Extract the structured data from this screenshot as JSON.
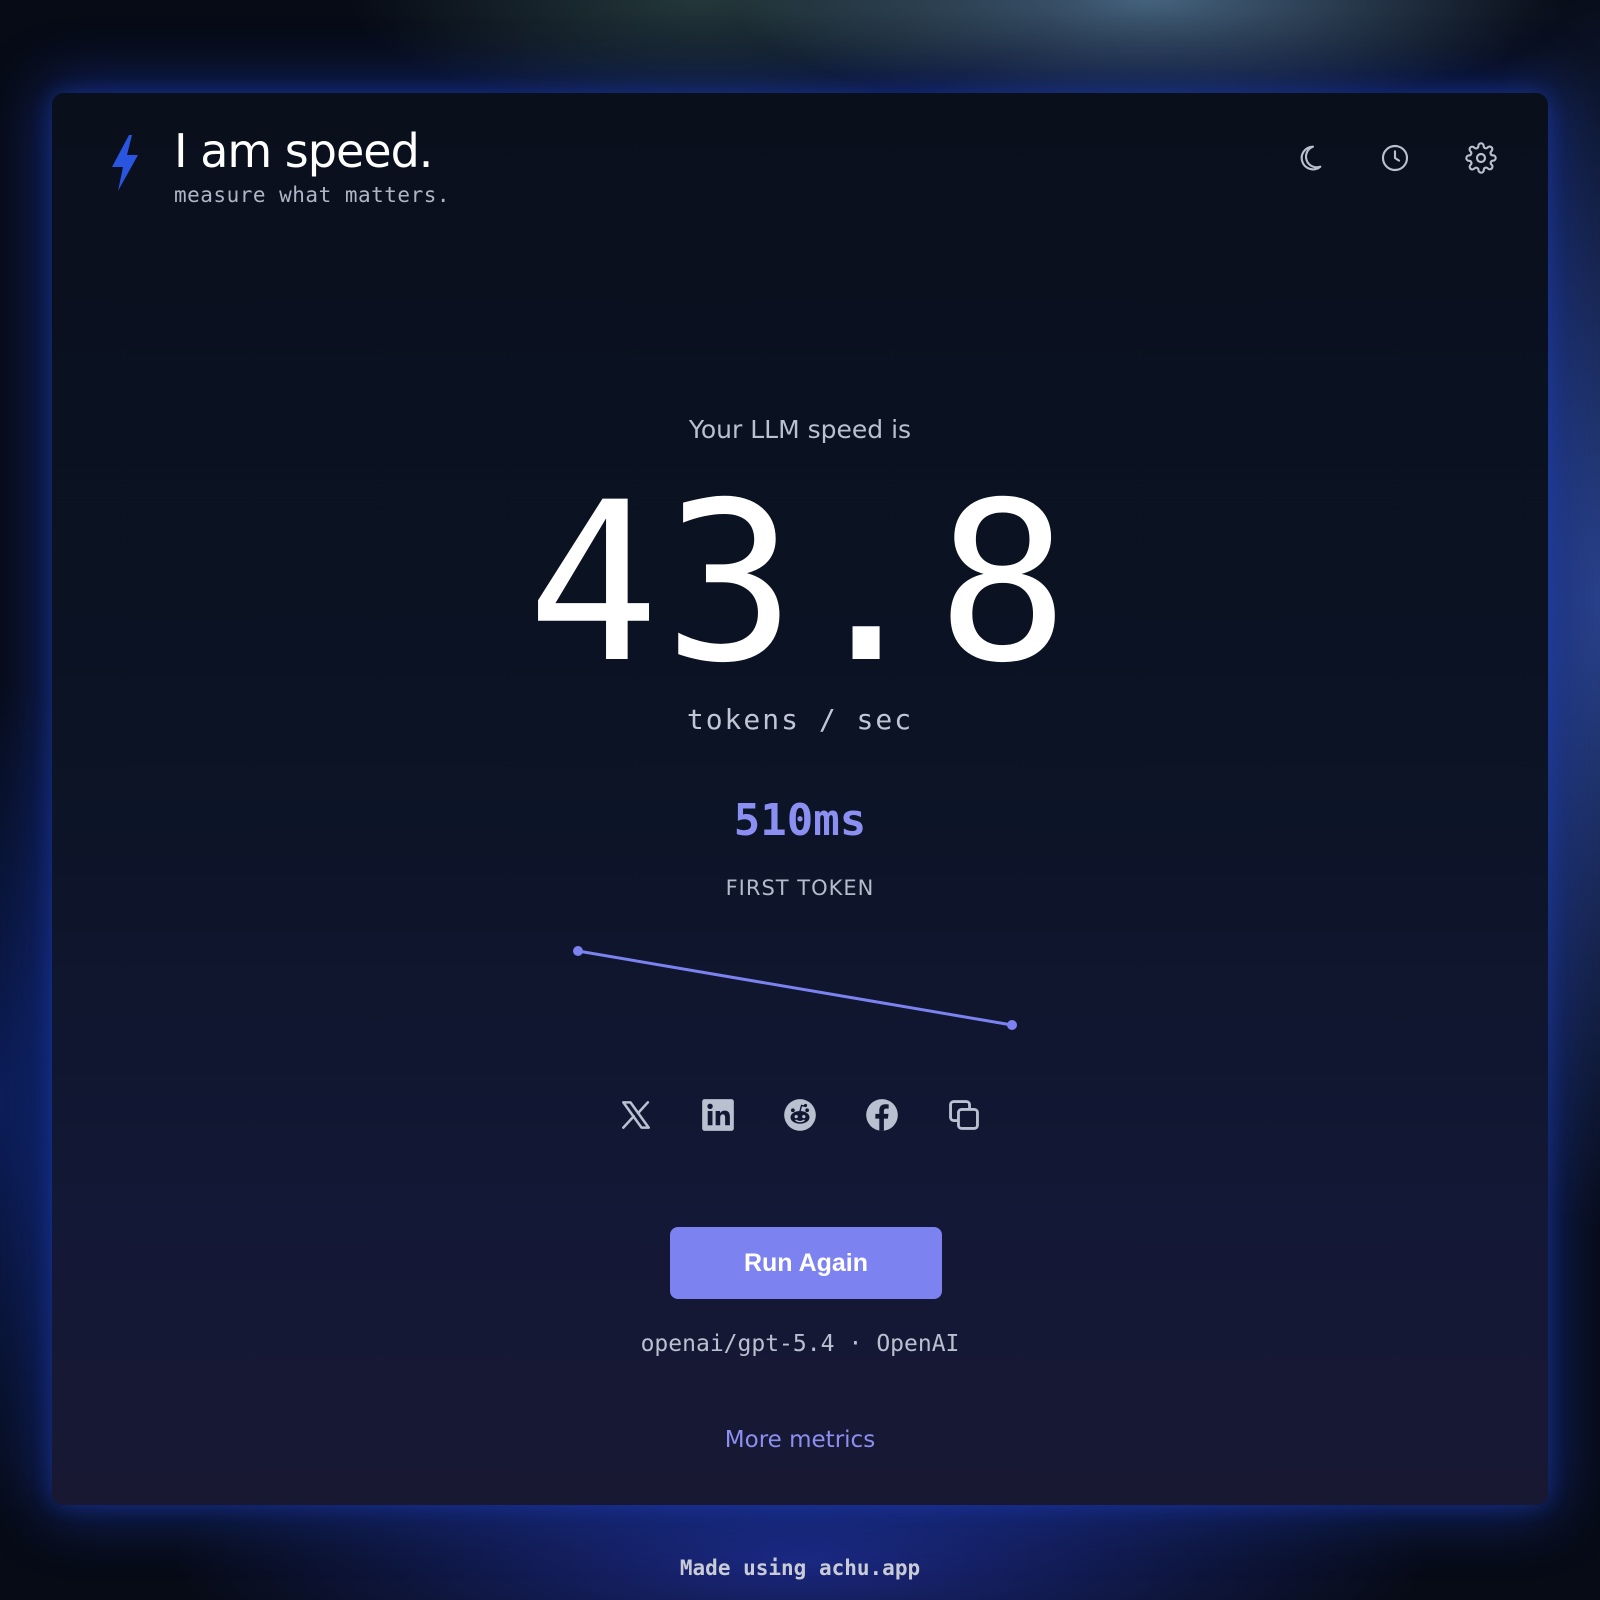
{
  "app": {
    "title": "I am speed.",
    "tagline": "measure what matters.",
    "logo_icon": "lightning-bolt-icon",
    "accent_color": "#7c82f0",
    "logo_color": "#2a55e0"
  },
  "header_actions": [
    {
      "name": "theme-toggle-button",
      "icon": "moon-icon"
    },
    {
      "name": "history-button",
      "icon": "clock-icon"
    },
    {
      "name": "settings-button",
      "icon": "gear-icon"
    }
  ],
  "result": {
    "label": "Your LLM speed is",
    "value": "43.8",
    "unit": "tokens / sec",
    "first_token_value": "510ms",
    "first_token_label": "FIRST TOKEN"
  },
  "sparkline": {
    "points": [
      1.0,
      0.0
    ],
    "color": "#7c82f0"
  },
  "share": [
    {
      "name": "share-x-button",
      "icon": "x-logo-icon"
    },
    {
      "name": "share-linkedin-button",
      "icon": "linkedin-icon"
    },
    {
      "name": "share-reddit-button",
      "icon": "reddit-icon"
    },
    {
      "name": "share-facebook-button",
      "icon": "facebook-icon"
    },
    {
      "name": "copy-button",
      "icon": "copy-icon"
    }
  ],
  "actions": {
    "run_again_label": "Run Again",
    "more_metrics_label": "More metrics"
  },
  "model": {
    "id": "openai/gpt-5.4",
    "separator": "·",
    "provider": "OpenAI"
  },
  "footer": {
    "text": "Made using achu.app"
  }
}
